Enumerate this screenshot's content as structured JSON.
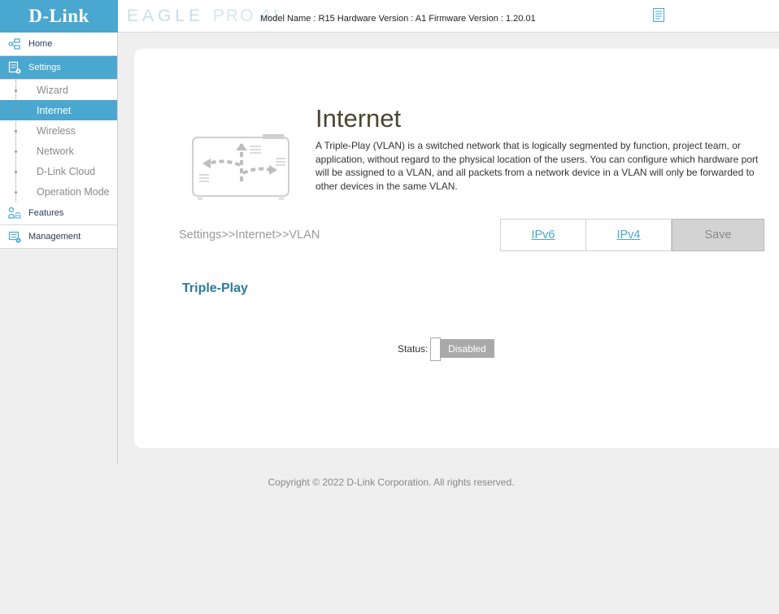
{
  "header": {
    "logo": "D-Link",
    "brand_part1": "EAGLE",
    "brand_part2": "PRO AI",
    "model_info": "Model Name : R15 Hardware Version : A1 Firmware Version : 1.20.01",
    "icons": [
      "document-icon"
    ]
  },
  "sidebar": {
    "items": [
      {
        "label": "Home",
        "icon": "home-network-icon"
      },
      {
        "label": "Settings",
        "icon": "settings-icon",
        "active": true
      },
      {
        "label": "Features",
        "icon": "features-icon"
      },
      {
        "label": "Management",
        "icon": "management-icon"
      }
    ],
    "sub_items": [
      {
        "label": "Wizard"
      },
      {
        "label": "Internet",
        "active": true
      },
      {
        "label": "Wireless"
      },
      {
        "label": "Network"
      },
      {
        "label": "D-Link Cloud"
      },
      {
        "label": "Operation Mode"
      }
    ]
  },
  "main": {
    "title": "Internet",
    "description": "A Triple-Play (VLAN) is a switched network that is logically segmented by function, project team, or application, without regard to the physical location of the users. You can configure which hardware port will be assigned to a VLAN, and all packets from a network device in a VLAN will only be forwarded to other devices in the same VLAN.",
    "breadcrumb": "Settings>>Internet>>VLAN",
    "buttons": {
      "ipv6": "IPv6",
      "ipv4": "IPv4",
      "save": "Save"
    },
    "section_title": "Triple-Play",
    "status_label": "Status:",
    "status_value": "Disabled"
  },
  "footer": {
    "copyright": "Copyright © 2022 D-Link Corporation. All rights reserved."
  },
  "colors": {
    "accent": "#4aa7cf",
    "section_title": "#2a7b9a",
    "toggle_off": "#a9a9a9"
  }
}
